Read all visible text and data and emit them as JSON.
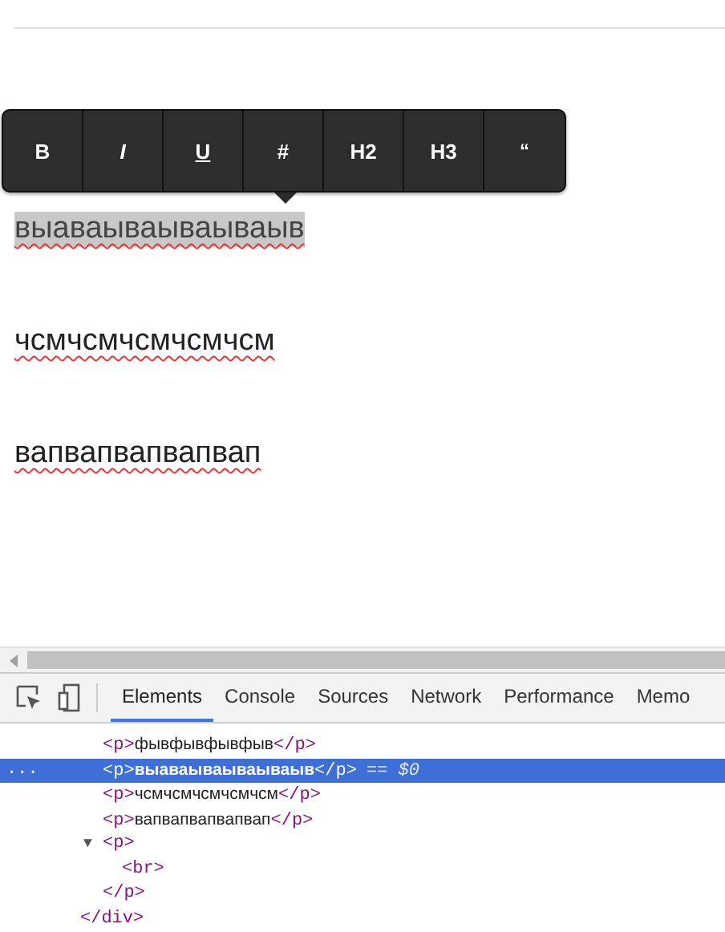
{
  "toolbar": {
    "buttons": [
      {
        "label": "B",
        "kind": "bold"
      },
      {
        "label": "I",
        "kind": "italic"
      },
      {
        "label": "U",
        "kind": "underline"
      },
      {
        "label": "#",
        "kind": "plain"
      },
      {
        "label": "H2",
        "kind": "plain"
      },
      {
        "label": "H3",
        "kind": "plain"
      },
      {
        "label": "“",
        "kind": "quote"
      }
    ]
  },
  "editor": {
    "paragraphs": [
      {
        "text": "выаваываываываыв",
        "selected": true
      },
      {
        "text": "чсмчсмчсмчсмчсм",
        "selected": false
      },
      {
        "text": "вапвапвапвапвап",
        "selected": false
      }
    ]
  },
  "devtools": {
    "tabs": [
      {
        "label": "Elements",
        "selected": true
      },
      {
        "label": "Console",
        "selected": false
      },
      {
        "label": "Sources",
        "selected": false
      },
      {
        "label": "Network",
        "selected": false
      },
      {
        "label": "Performance",
        "selected": false
      },
      {
        "label": "Memo",
        "selected": false
      }
    ],
    "nodes": [
      {
        "open_tag": "<p>",
        "text": "фывфывфывфыв",
        "close_tag": "</p>",
        "selected": false
      },
      {
        "open_tag": "<p>",
        "text": "выаваываываываыв",
        "close_tag": "</p>",
        "selected": true,
        "ellipsis": "...",
        "console_ref": "== $0"
      },
      {
        "open_tag": "<p>",
        "text": "чсмчсмчсмчсмчсм",
        "close_tag": "</p>",
        "selected": false
      },
      {
        "open_tag": "<p>",
        "text": "вапвапвапвапвап",
        "close_tag": "</p>",
        "selected": false
      },
      {
        "open_tag": "<p>",
        "expanded": true,
        "selected": false,
        "toggle": "▼",
        "close_tag": "</p>",
        "children": [
          {
            "open_tag": "<br>",
            "selected": false
          }
        ]
      }
    ],
    "closing_tag": "</div>"
  }
}
